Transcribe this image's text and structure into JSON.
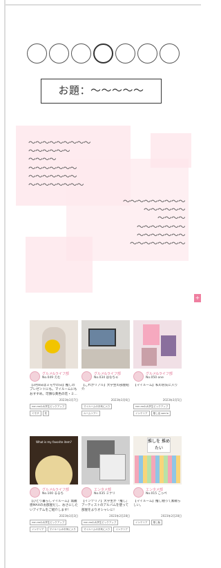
{
  "circles": [
    "",
    "",
    "",
    "",
    "",
    "",
    ""
  ],
  "active_circle_index": 3,
  "topic": "お題：〜〜〜〜〜",
  "text_left": [
    "〜〜〜〜〜〜〜〜〜",
    "〜〜〜〜〜〜",
    "〜〜〜〜",
    "〜〜〜〜〜〜〜",
    "〜〜〜〜〜〜〜",
    "〜〜〜〜〜〜〜〜"
  ],
  "text_right": [
    "〜〜〜〜〜〜〜〜〜",
    "〜〜〜〜〜〜",
    "〜〜〜〜",
    "〜〜〜〜〜〜〜",
    "〜〜〜〜〜〜〜",
    "〜〜〜〜〜〜〜〜"
  ],
  "side_tab": "+",
  "cards": [
    {
      "thumb": "t1",
      "dept": "グルメ&ライフ部",
      "name": "No.049 えむ",
      "title": "【3月8日はミモザの日】推しのプレゼントにも。マイルームにもおすすめ。可憐な黄色の花・ミ...",
      "date": "2023年3月7日",
      "tags": [
        "non-noわ大学生ピックアップ",
        "ミモザ",
        "花"
      ]
    },
    {
      "thumb": "t2",
      "dept": "グルメ&ライフ部",
      "name": "No.034 はなちゃ",
      "title": "【これがリアル】大学生の部屋紹介",
      "date": "2023年3月6日",
      "tags": [
        "マイルームのお気に入り",
        "ルームツアー"
      ]
    },
    {
      "thumb": "t3",
      "dept": "グルメ&ライフ部",
      "name": "No.050 one",
      "title": "【マイルーム】私のお気に入り",
      "date": "2023年3月5日",
      "tags": [
        "non-noわ大学生ピックアップ",
        "インテリア",
        "推し活 sanrio"
      ]
    },
    {
      "thumb": "t4",
      "thumb_text": "What is my favorite item?",
      "dept": "グルメ&ライフ部",
      "name": "No.100 るるち",
      "title": "【ひとり暮らしマイルーム】無難感MAXのお部屋だし、おさにしたいアイテムをご紹介します！",
      "date": "2023年3月3日",
      "tags": [
        "non-noわ大学生ピックアップ",
        "インテリア",
        "マイルームのお気に入り"
      ]
    },
    {
      "thumb": "t5",
      "dept": "エンタメ部",
      "name": "No.035 ミナリ",
      "title": "【インテリア】大学生が「推し」アーティストのアルバムを使って部屋をよりオシャレに！",
      "date": "2023年2月28日",
      "tags": [
        "non-noわ大学生ピックアップ",
        "マイルームのお気に入り",
        "インテリア"
      ]
    },
    {
      "thumb": "t6",
      "thumb_text": "推しを 推めたい",
      "dept": "エンタメ部",
      "name": "No.015 こっぺ",
      "title": "【マイルーム】推し勉って素敵らしい。",
      "date": "2023年2月28日",
      "tags": [
        "インテリア",
        "推し勉"
      ]
    }
  ]
}
